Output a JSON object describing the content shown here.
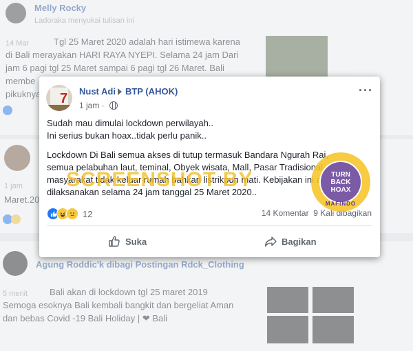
{
  "background_posts": {
    "post1": {
      "name": "Melly Rocky",
      "sub": "Ladoraka menyukai tulisan ini",
      "date": "14 Mar",
      "lines": [
        "Tgl 25 Maret 2020 adalah hari istimewa karena",
        "di Bali merayakan HARI RAYA NYEPI. Selama 24 jam Dari",
        "jam 6 pagi tgl 25 Maret sampai 6 pagi tgl 26 Maret. Bali",
        "membe",
        "pikuknya"
      ]
    },
    "post2": {
      "date": "1 jam",
      "line": "Maret.20"
    },
    "post3": {
      "name": "Agung Roddic'k dibagi Postingan Rdck_Clothing",
      "date": "5 menit",
      "lines": [
        "Bali akan di lockdown tgl 25 maret 2019",
        "Semoga esoknya Bali kembali bangkit dan bergeliat Aman",
        "dan bebas Covid -19 Bali Holiday | ❤ Bali"
      ]
    }
  },
  "post": {
    "author": "Nust Adi",
    "group": "BTP (AHOK)",
    "time": "1 jam",
    "body_line1": "Sudah mau dimulai lockdown perwilayah..",
    "body_line2": "Ini serius bukan hoax..tidak perlu panik..",
    "body_para": [
      "Lockdown Di Bali semua akses di tutup termasuk Bandara Ngurah Rai,",
      "semua pelabuhan laut, teminal, Obyek wisata, Mall, Pasar Tradisional, dan",
      "masyarakat tidak keluar rumah bahkan listrikpun mati. Kebijakan ini akan",
      "dilaksanakan selama 24 jam tanggal 25 Maret 2020.."
    ],
    "reaction_count": "12",
    "comments": "14 Komentar",
    "shares": "9 Kali dibagikan",
    "like_label": "Suka",
    "share_label": "Bagikan"
  },
  "watermark": "SCREENSHOT BY",
  "seal": {
    "line1": "TURN",
    "line2": "BACK",
    "line3": "HOAX",
    "bottom": "MAFINDO"
  },
  "colors": {
    "link": "#365899",
    "like_blue": "#2078f4",
    "watermark": "#f5be28",
    "seal_purple": "#7b5aa6"
  }
}
